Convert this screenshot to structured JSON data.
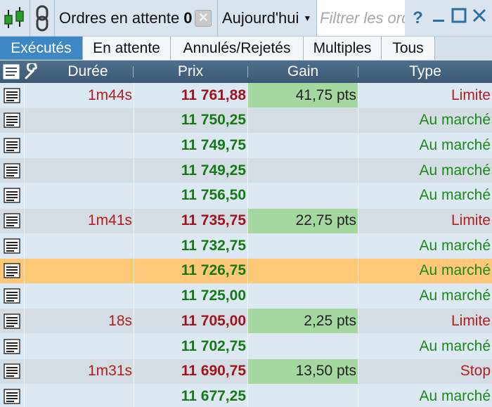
{
  "toolbar": {
    "chart_icon": "chart-candles-icon",
    "link_icon": "chain-link-icon",
    "title": "Ordres en attente",
    "count": "0",
    "clear_icon": "clear-x-icon",
    "period": "Aujourd'hui",
    "filter_placeholder": "Filtrer les ordres",
    "filter_value": "",
    "help_label": "?",
    "minimize_label": "_",
    "maximize_label": "☐",
    "close_label": "✕"
  },
  "tabs": [
    {
      "label": "Exécutés",
      "active": true
    },
    {
      "label": "En attente",
      "active": false
    },
    {
      "label": "Annulés/Rejetés",
      "active": false
    },
    {
      "label": "Multiples",
      "active": false
    },
    {
      "label": "Tous",
      "active": false
    }
  ],
  "columns": {
    "list_icon": "list-icon",
    "settings_icon": "wrench-icon",
    "duree": "Durée",
    "prix": "Prix",
    "gain": "Gain",
    "type": "Type"
  },
  "colors": {
    "prix_red": "#a0141e",
    "prix_green": "#157a15",
    "type_red": "#b01e1e",
    "type_green": "#1b8a1b",
    "gain_fill": "#a4d8a0",
    "selected_row": "#ffc878",
    "active_tab": "#3e87c5"
  },
  "rows": [
    {
      "duree": "1m44s",
      "prix": "11 761,88",
      "prix_color": "red",
      "gain": "41,75 pts",
      "type": "Limite",
      "type_color": "red"
    },
    {
      "duree": "",
      "prix": "11 750,25",
      "prix_color": "green",
      "gain": "",
      "type": "Au marché",
      "type_color": "green"
    },
    {
      "duree": "",
      "prix": "11 749,75",
      "prix_color": "green",
      "gain": "",
      "type": "Au marché",
      "type_color": "green"
    },
    {
      "duree": "",
      "prix": "11 749,25",
      "prix_color": "green",
      "gain": "",
      "type": "Au marché",
      "type_color": "green"
    },
    {
      "duree": "",
      "prix": "11 756,50",
      "prix_color": "green",
      "gain": "",
      "type": "Au marché",
      "type_color": "green"
    },
    {
      "duree": "1m41s",
      "prix": "11 735,75",
      "prix_color": "red",
      "gain": "22,75 pts",
      "type": "Limite",
      "type_color": "red"
    },
    {
      "duree": "",
      "prix": "11 732,75",
      "prix_color": "green",
      "gain": "",
      "type": "Au marché",
      "type_color": "green"
    },
    {
      "duree": "",
      "prix": "11 726,75",
      "prix_color": "green",
      "gain": "",
      "type": "Au marché",
      "type_color": "green",
      "selected": true
    },
    {
      "duree": "",
      "prix": "11 725,00",
      "prix_color": "green",
      "gain": "",
      "type": "Au marché",
      "type_color": "green"
    },
    {
      "duree": "18s",
      "prix": "11 705,00",
      "prix_color": "red",
      "gain": "2,25 pts",
      "type": "Limite",
      "type_color": "red"
    },
    {
      "duree": "",
      "prix": "11 702,75",
      "prix_color": "green",
      "gain": "",
      "type": "Au marché",
      "type_color": "green"
    },
    {
      "duree": "1m31s",
      "prix": "11 690,75",
      "prix_color": "red",
      "gain": "13,50 pts",
      "type": "Stop",
      "type_color": "red"
    },
    {
      "duree": "",
      "prix": "11 677,25",
      "prix_color": "green",
      "gain": "",
      "type": "Au marché",
      "type_color": "green"
    }
  ]
}
